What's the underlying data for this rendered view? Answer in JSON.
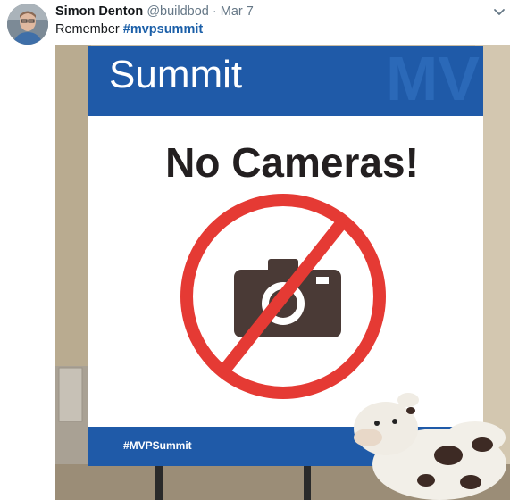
{
  "tweet": {
    "author_name": "Simon Denton",
    "handle": "@buildbod",
    "separator": "·",
    "date": "Mar 7",
    "text_prefix": "Remember ",
    "hashtag": "#mvpsummit"
  },
  "photo": {
    "banner_title": "Summit",
    "banner_watermark": "MV",
    "heading": "No Cameras!",
    "footer_tag": "#MVPSummit"
  },
  "colors": {
    "sign_blue": "#1f5aa8",
    "prohibition_red": "#e53a34",
    "hashtag_blue": "#1b5fa8"
  },
  "icons": {
    "caret": "chevron-down-icon",
    "sign_symbol": "camera-icon"
  }
}
